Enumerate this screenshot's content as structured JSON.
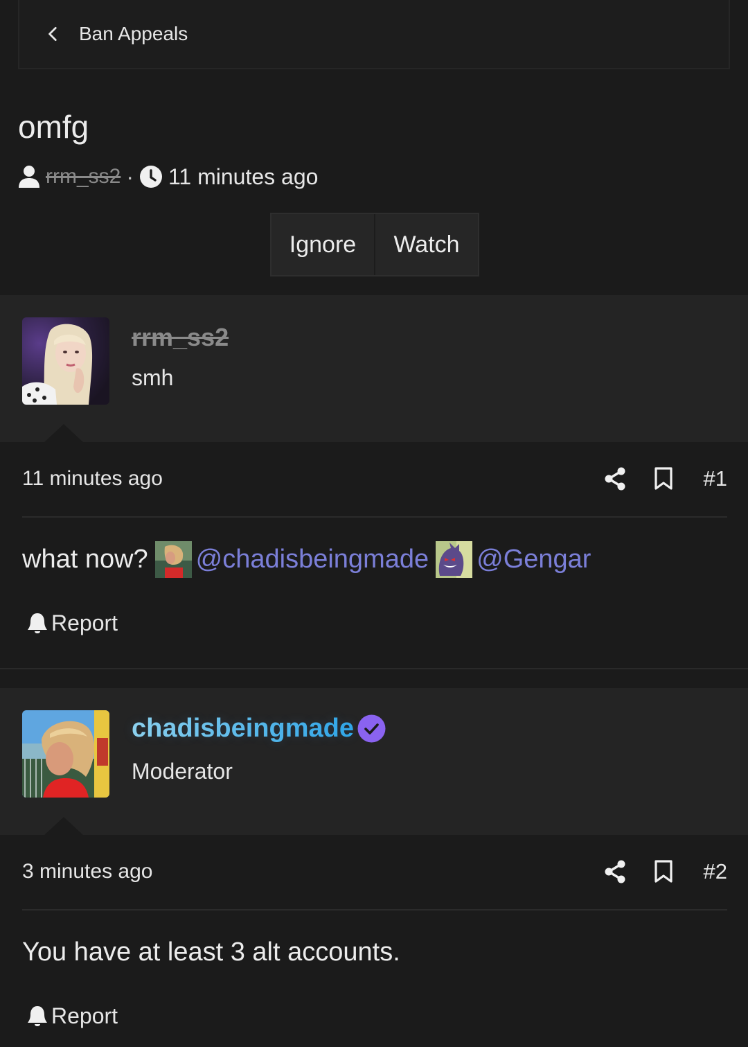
{
  "breadcrumb": {
    "label": "Ban Appeals"
  },
  "thread": {
    "title": "omfg",
    "author": "rrm_ss2",
    "separator": "·",
    "time": "11 minutes ago"
  },
  "actions": {
    "ignore": "Ignore",
    "watch": "Watch"
  },
  "posts": [
    {
      "username": "rrm_ss2",
      "user_title": "smh",
      "time": "11 minutes ago",
      "number": "#1",
      "body_text": "what now?",
      "mentions": [
        "@chadisbeingmade",
        "@Gengar"
      ],
      "report": "Report"
    },
    {
      "username": "chadisbeingmade",
      "user_title": "Moderator",
      "time": "3 minutes ago",
      "number": "#2",
      "body_text": "You have at least 3 alt accounts.",
      "report": "Report"
    }
  ],
  "colors": {
    "background": "#1b1b1b",
    "post_header": "#242424",
    "mention": "#7b7fd8",
    "verified": "#8a63f0",
    "mod_name_start": "#8fd3ee",
    "mod_name_end": "#2fa6e6"
  }
}
